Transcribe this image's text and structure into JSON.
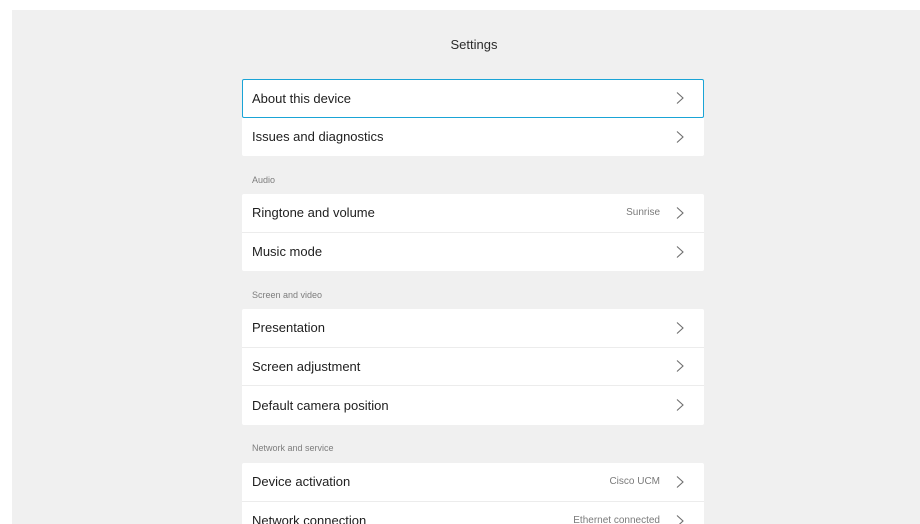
{
  "header": {
    "title": "Settings"
  },
  "groups": [
    {
      "label": "",
      "items": [
        {
          "label": "About this device",
          "value": "",
          "focused": true
        },
        {
          "label": "Issues and diagnostics",
          "value": ""
        }
      ]
    },
    {
      "label": "Audio",
      "items": [
        {
          "label": "Ringtone and volume",
          "value": "Sunrise"
        },
        {
          "label": "Music mode",
          "value": ""
        }
      ]
    },
    {
      "label": "Screen and video",
      "items": [
        {
          "label": "Presentation",
          "value": ""
        },
        {
          "label": "Screen adjustment",
          "value": ""
        },
        {
          "label": "Default camera position",
          "value": ""
        }
      ]
    },
    {
      "label": "Network and service",
      "items": [
        {
          "label": "Device activation",
          "value": "Cisco UCM"
        },
        {
          "label": "Network connection",
          "value": "Ethernet connected"
        }
      ]
    }
  ],
  "colors": {
    "focus": "#1aa4d6",
    "background": "#f0f0f0",
    "card": "#ffffff"
  },
  "icons": {
    "row_chevron": "chevron-right-icon"
  }
}
